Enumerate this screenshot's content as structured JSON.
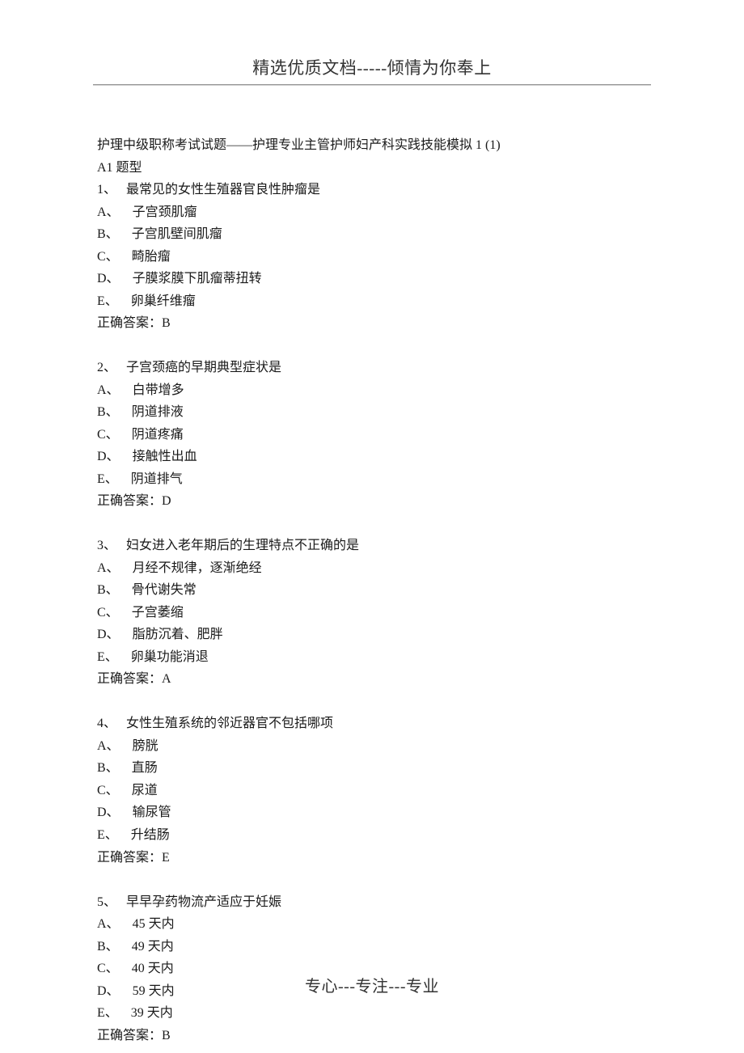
{
  "header": "精选优质文档-----倾情为你奉上",
  "footer": "专心---专注---专业",
  "intro_line": "护理中级职称考试试题——护理专业主管护师妇产科实践技能模拟 1 (1)",
  "section_type": "A1 题型",
  "questions": [
    {
      "num": "1、",
      "stem": "最常见的女性生殖器官良性肿瘤是",
      "options": [
        {
          "label": "A、",
          "text": "子宫颈肌瘤"
        },
        {
          "label": "B、",
          "text": "子宫肌壁间肌瘤"
        },
        {
          "label": "C、",
          "text": "畸胎瘤"
        },
        {
          "label": "D、",
          "text": "子膜浆膜下肌瘤蒂扭转"
        },
        {
          "label": "E、",
          "text": "卵巢纤维瘤"
        }
      ],
      "answer": "正确答案：B"
    },
    {
      "num": "2、",
      "stem": "子宫颈癌的早期典型症状是",
      "options": [
        {
          "label": "A、",
          "text": "白带增多"
        },
        {
          "label": "B、",
          "text": "阴道排液"
        },
        {
          "label": "C、",
          "text": "阴道疼痛"
        },
        {
          "label": "D、",
          "text": "接触性出血"
        },
        {
          "label": "E、",
          "text": "阴道排气"
        }
      ],
      "answer": "正确答案：D"
    },
    {
      "num": "3、",
      "stem": "妇女进入老年期后的生理特点不正确的是",
      "options": [
        {
          "label": "A、",
          "text": "月经不规律，逐渐绝经"
        },
        {
          "label": "B、",
          "text": "骨代谢失常"
        },
        {
          "label": "C、",
          "text": "子宫萎缩"
        },
        {
          "label": "D、",
          "text": "脂肪沉着、肥胖"
        },
        {
          "label": "E、",
          "text": "卵巢功能消退"
        }
      ],
      "answer": "正确答案：A"
    },
    {
      "num": "4、",
      "stem": "女性生殖系统的邻近器官不包括哪项",
      "options": [
        {
          "label": "A、",
          "text": "膀胱"
        },
        {
          "label": "B、",
          "text": "直肠"
        },
        {
          "label": "C、",
          "text": "尿道"
        },
        {
          "label": "D、",
          "text": "输尿管"
        },
        {
          "label": "E、",
          "text": "升结肠"
        }
      ],
      "answer": "正确答案：E"
    },
    {
      "num": "5、",
      "stem": "早早孕药物流产适应于妊娠",
      "options": [
        {
          "label": "A、",
          "text": "45 天内"
        },
        {
          "label": "B、",
          "text": "49 天内"
        },
        {
          "label": "C、",
          "text": "40 天内"
        },
        {
          "label": "D、",
          "text": "59 天内"
        },
        {
          "label": "E、",
          "text": "39 天内"
        }
      ],
      "answer": "正确答案：B"
    }
  ]
}
